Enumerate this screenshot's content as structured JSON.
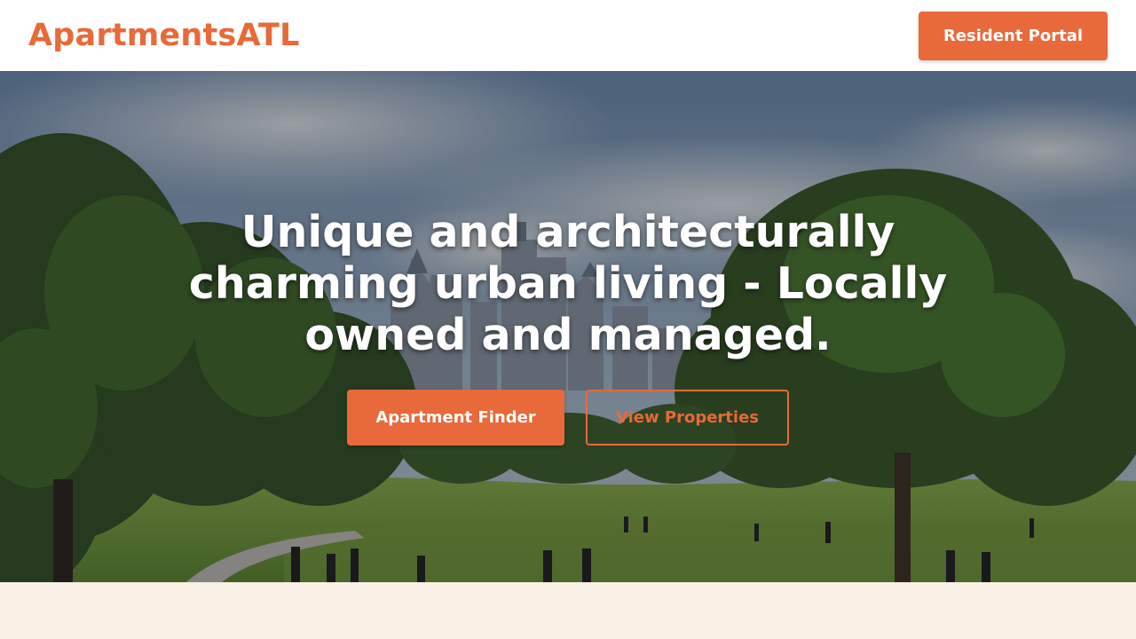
{
  "header": {
    "logo_text": "ApartmentsATL",
    "portal_button_label": "Resident Portal"
  },
  "hero": {
    "headline": "Unique and architecturally charming urban living - Locally owned and managed.",
    "primary_button_label": "Apartment Finder",
    "secondary_button_label": "View Properties",
    "background_image": "park-skyline-photo"
  },
  "colors": {
    "accent": "#e8693a",
    "header_bg": "#ffffff",
    "page_bg": "#f9f0e6",
    "hero_text": "#ffffff"
  }
}
